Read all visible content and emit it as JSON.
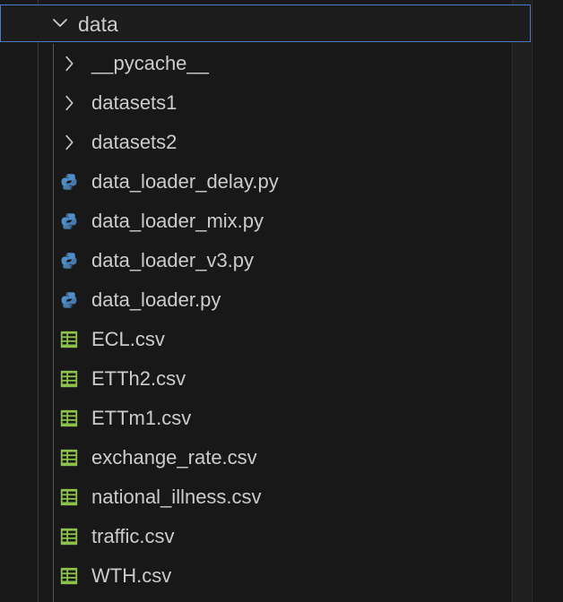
{
  "explorer": {
    "folder": {
      "name": "data",
      "expanded": true,
      "icon": "chevron-down-icon"
    },
    "items": [
      {
        "label": "__pycache__",
        "kind": "folder",
        "icon": "chevron-right-icon"
      },
      {
        "label": "datasets1",
        "kind": "folder",
        "icon": "chevron-right-icon"
      },
      {
        "label": "datasets2",
        "kind": "folder",
        "icon": "chevron-right-icon"
      },
      {
        "label": "data_loader_delay.py",
        "kind": "python",
        "icon": "python-icon"
      },
      {
        "label": "data_loader_mix.py",
        "kind": "python",
        "icon": "python-icon"
      },
      {
        "label": "data_loader_v3.py",
        "kind": "python",
        "icon": "python-icon"
      },
      {
        "label": "data_loader.py",
        "kind": "python",
        "icon": "python-icon"
      },
      {
        "label": "ECL.csv",
        "kind": "csv",
        "icon": "csv-table-icon"
      },
      {
        "label": "ETTh2.csv",
        "kind": "csv",
        "icon": "csv-table-icon"
      },
      {
        "label": "ETTm1.csv",
        "kind": "csv",
        "icon": "csv-table-icon"
      },
      {
        "label": "exchange_rate.csv",
        "kind": "csv",
        "icon": "csv-table-icon"
      },
      {
        "label": "national_illness.csv",
        "kind": "csv",
        "icon": "csv-table-icon"
      },
      {
        "label": "traffic.csv",
        "kind": "csv",
        "icon": "csv-table-icon"
      },
      {
        "label": "WTH.csv",
        "kind": "csv",
        "icon": "csv-table-icon"
      }
    ]
  },
  "colors": {
    "background": "#181818",
    "text": "#cccccc",
    "focus_border": "#4a7ec0",
    "python_blue": "#4f8cc9",
    "python_yellow": "#e5c453",
    "csv_green": "#8bc34a"
  }
}
